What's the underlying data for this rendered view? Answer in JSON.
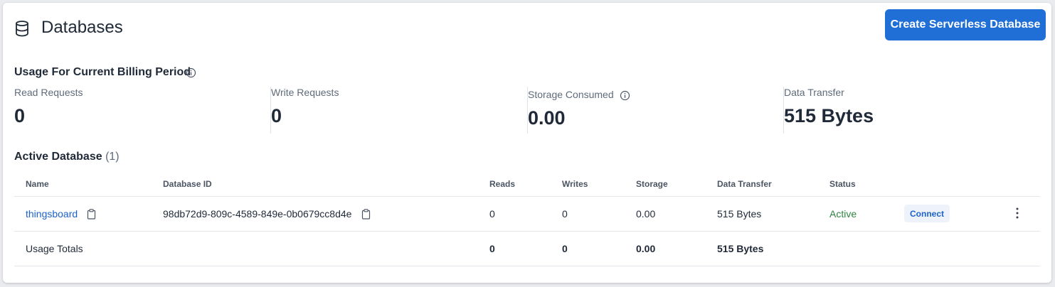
{
  "header": {
    "title": "Databases",
    "icon": "database-icon",
    "create_button_label": "Create Serverless Database"
  },
  "usage": {
    "title": "Usage For Current Billing Period",
    "metrics": [
      {
        "label": "Read Requests",
        "value": "0"
      },
      {
        "label": "Write Requests",
        "value": "0"
      },
      {
        "label": "Storage Consumed",
        "value": "0.00"
      },
      {
        "label": "Data Transfer",
        "value": "515 Bytes"
      }
    ]
  },
  "active": {
    "title": "Active Database",
    "count": "(1)"
  },
  "table": {
    "columns": [
      "Name",
      "Database ID",
      "Reads",
      "Writes",
      "Storage",
      "Data Transfer",
      "Status"
    ],
    "rows": [
      {
        "name": "thingsboard",
        "id": "98db72d9-809c-4589-849e-0b0679cc8d4e",
        "reads": "0",
        "writes": "0",
        "storage": "0.00",
        "transfer": "515 Bytes",
        "status": "Active",
        "action_label": "Connect"
      }
    ],
    "totals": {
      "label": "Usage Totals",
      "reads": "0",
      "writes": "0",
      "storage": "0.00",
      "transfer": "515 Bytes"
    }
  },
  "colors": {
    "primary": "#1f6fd6",
    "link": "#1d62c9",
    "status_active": "#2e8540"
  }
}
